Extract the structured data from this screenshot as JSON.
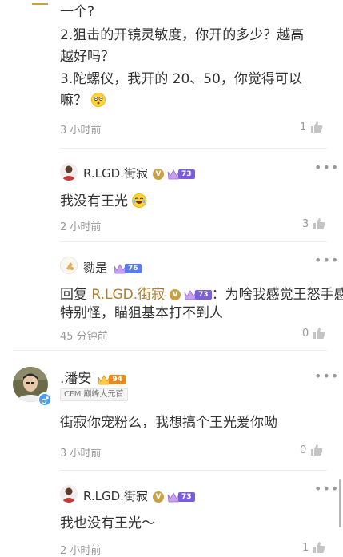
{
  "top_comment": {
    "line1": "一个?",
    "line2": "2.狙击的开镜灵敏度，你开的多少？越高",
    "line3": "越好吗？",
    "line4": "3.陀螺仪，我开的 20、50，你觉得可以",
    "line5": "嘛？",
    "time": "3 小时前",
    "likes": "1"
  },
  "reply1": {
    "username": "R.LGD.街寂",
    "verified": "V",
    "level": "73",
    "text": "我没有王光",
    "time": "2 小时前",
    "likes": "3"
  },
  "reply2": {
    "username": "勠是",
    "level": "76",
    "reply_prefix": "回复",
    "reply_to": "R.LGD.街寂",
    "reply_to_verified": "V",
    "reply_to_level": "73",
    "text_part1": "：为啥我感觉王怒手感",
    "text_line2": "特别怪，瞄狙基本打不到人",
    "time": "45 分钟前",
    "likes": "0"
  },
  "comment2": {
    "username": ".潘安",
    "level": "94",
    "tag": "CFM 巅峰大元首",
    "text": "街寂你宠粉么，我想搞个王光爱你呦",
    "time": "3 小时前",
    "likes": "0"
  },
  "reply3": {
    "username": "R.LGD.街寂",
    "verified": "V",
    "level": "73",
    "text": "我也没有王光～",
    "time": "2 小时前",
    "likes": "1"
  },
  "more_label": "•••",
  "colors": {
    "gold": "#c9a143",
    "purple_pill": "#7b5de0",
    "blue_pill": "#5a7cf0",
    "orange_pill": "#e98a1f",
    "male_badge": "#4a9df0"
  }
}
